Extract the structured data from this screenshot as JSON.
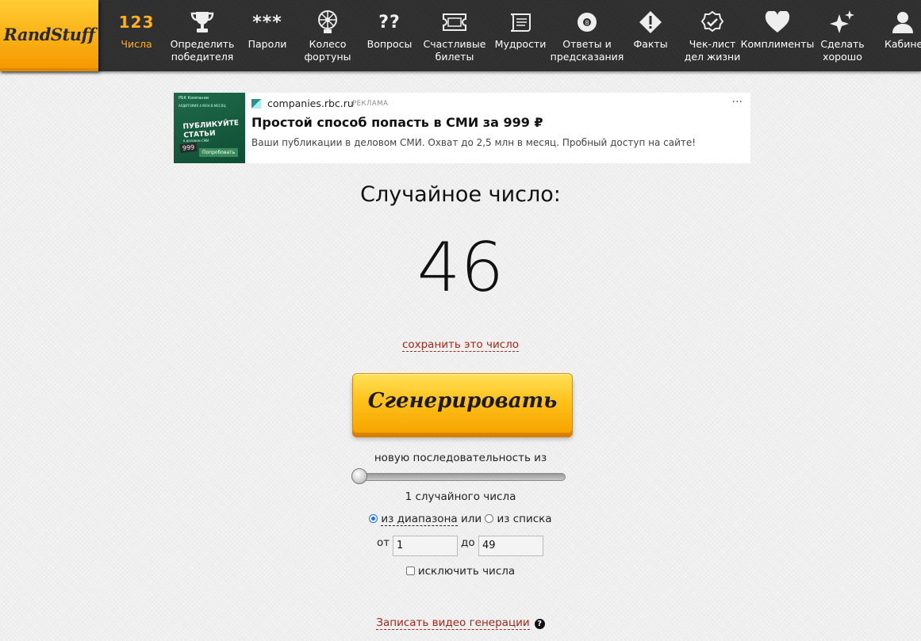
{
  "brand": {
    "logo_text": "RandStuff"
  },
  "nav": {
    "items": [
      {
        "label": "Числа",
        "icon_text": "123",
        "icon": "numbers-icon",
        "active": true
      },
      {
        "label": "Определить\nпобедителя",
        "icon": "trophy-icon"
      },
      {
        "label": "Пароли",
        "icon_text": "***",
        "icon": "asterisks-icon"
      },
      {
        "label": "Колесо\nфортуны",
        "icon": "wheel-icon"
      },
      {
        "label": "Вопросы",
        "icon_text": "??",
        "icon": "question-icon"
      },
      {
        "label": "Счастливые\nбилеты",
        "icon": "ticket-icon"
      },
      {
        "label": "Мудрости",
        "icon": "scroll-icon"
      },
      {
        "label": "Ответы и\nпредсказания",
        "icon": "magic-ball-icon"
      },
      {
        "label": "Факты",
        "icon": "exclamation-icon"
      },
      {
        "label": "Чек-лист\nдел жизни",
        "icon": "checklist-badge-icon"
      },
      {
        "label": "Комплименты",
        "icon": "heart-icon"
      },
      {
        "label": "Сделать\nхорошо",
        "icon": "sparkle-icon"
      },
      {
        "label": "Кабинет",
        "icon": "user-icon"
      }
    ]
  },
  "ad": {
    "domain": "companies.rbc.ru",
    "tag": "РЕКЛАМА",
    "more": "···",
    "title": "Простой способ попасть в СМИ за 999 ₽",
    "description": "Ваши публикации в деловом СМИ. Охват до 2,5 млн в месяц. Пробный доступ на сайте!",
    "image": {
      "line1": "РБК Компании",
      "line2": "АУДИТОРИЯ 4 МЛН В МЕСЯЦ",
      "headline": "ПУБЛИКУЙТЕ\nСТАТЬИ",
      "sub": "в деловом СМИ",
      "price": "999",
      "cta": "Попробовать"
    }
  },
  "main": {
    "heading": "Случайное число:",
    "result": "46",
    "save_link": "сохранить это число",
    "generate_label": "Сгенерировать",
    "sequence_label": "новую последовательность из",
    "count_label": "1 случайного числа",
    "slider": {
      "value": 1,
      "min": 1,
      "max": 100
    },
    "mode": {
      "range_label": "из диапазона",
      "or": "или",
      "list_label": "из списка",
      "selected": "range"
    },
    "range": {
      "from_label": "от",
      "from_value": "1",
      "to_label": "до",
      "to_value": "49"
    },
    "exclude_label": "исключить числа",
    "video_link": "Записать видео генерации",
    "help": "?"
  }
}
